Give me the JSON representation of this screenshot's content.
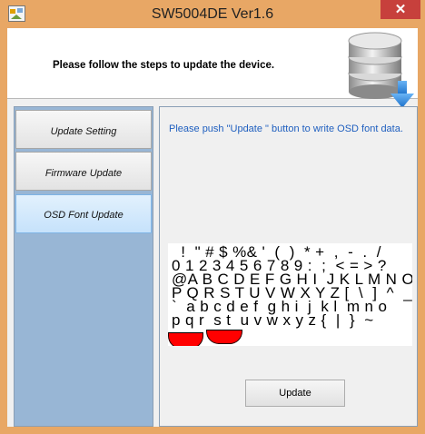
{
  "window": {
    "title": "SW5004DE Ver1.6",
    "close_glyph": "✕"
  },
  "header": {
    "instruction": "Please follow the steps to update the device."
  },
  "sidebar": {
    "items": [
      {
        "label": "Update Setting",
        "selected": false
      },
      {
        "label": "Firmware Update",
        "selected": false
      },
      {
        "label": "OSD Font Update",
        "selected": true
      }
    ]
  },
  "content": {
    "message": "Please push \"Update \" button to write OSD font data.",
    "font_lines": [
      "  !  \" # $ %& '  (  )  * +  ,  -  .  /",
      "0 1 2 3 4 5 6 7 8 9 :  ;  < = > ?",
      "@A B C D E F G H I  J K L M N O",
      "P Q R S T U V W X Y Z [  \\  ]  ^  _",
      "`  a b c d e f  g h i  j  k l  m n o",
      "p q r  s t  u v w x y z {  |  }  ~"
    ],
    "update_label": "Update"
  },
  "colors": {
    "frame": "#e8a765",
    "close": "#c7403c",
    "sidebar": "#98b6d5",
    "message_text": "#1f5fbf",
    "font_blob": "#ff0000"
  },
  "icons": [
    "app-icon",
    "database-download-icon",
    "close-icon"
  ]
}
